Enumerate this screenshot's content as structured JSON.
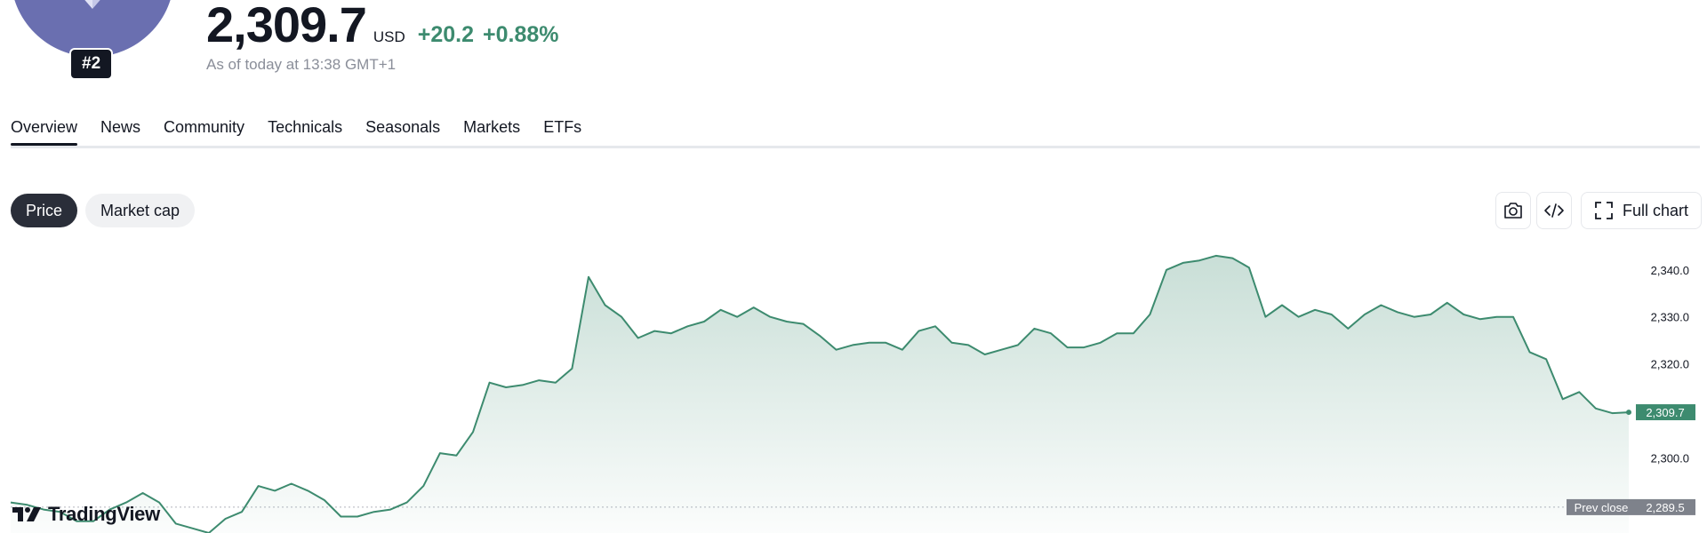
{
  "header": {
    "rank": "#2",
    "price": "2,309.7",
    "currency": "USD",
    "change": "+20.2",
    "change_pct": "+0.88%",
    "as_of": "As of today at 13:38 GMT+1",
    "logo_icon": "ethereum-diamond-icon",
    "logo_color": "#6a6fb0"
  },
  "tabs": [
    {
      "label": "Overview",
      "active": true
    },
    {
      "label": "News"
    },
    {
      "label": "Community"
    },
    {
      "label": "Technicals"
    },
    {
      "label": "Seasonals"
    },
    {
      "label": "Markets"
    },
    {
      "label": "ETFs"
    }
  ],
  "toggle": {
    "price_label": "Price",
    "market_cap_label": "Market cap"
  },
  "toolbar": {
    "full_chart_label": "Full chart",
    "snapshot_icon": "camera-icon",
    "embed_icon": "code-icon",
    "fullscreen_icon": "fullscreen-icon"
  },
  "branding": {
    "label": "TradingView"
  },
  "colors": {
    "line": "#3d8b6f",
    "positive": "#3d8b6f",
    "prev_close_badge": "#7e828b"
  },
  "chart_data": {
    "type": "area",
    "ylim": [
      2284,
      2344.5
    ],
    "y_ticks": [
      "2,340.0",
      "2,330.0",
      "2,320.0",
      "2,300.0"
    ],
    "y_tick_values": [
      2340,
      2330,
      2320,
      2300
    ],
    "last_price_label": "2,309.7",
    "last_price": 2309.7,
    "prev_close_text": "Prev close",
    "prev_close_label": "2,289.5",
    "prev_close": 2289.5,
    "values": [
      2290.5,
      2290,
      2289,
      2288.5,
      2286.5,
      2286.5,
      2289,
      2290.5,
      2292.5,
      2290.5,
      2286,
      2285,
      2284,
      2287,
      2288.5,
      2294,
      2293,
      2294.5,
      2293,
      2291,
      2287.5,
      2287.5,
      2288.5,
      2289,
      2290.5,
      2294,
      2301,
      2300.5,
      2305.5,
      2316,
      2315,
      2315.5,
      2316.5,
      2316,
      2319,
      2338.5,
      2332.5,
      2330,
      2325.5,
      2327,
      2326.5,
      2328,
      2329,
      2331.5,
      2330,
      2332,
      2330,
      2329,
      2328.5,
      2326,
      2323,
      2324,
      2324.5,
      2324.5,
      2323,
      2327,
      2328,
      2324.5,
      2324,
      2322,
      2323,
      2324,
      2327.5,
      2326.5,
      2323.5,
      2323.5,
      2324.5,
      2326.5,
      2326.5,
      2330.5,
      2340,
      2341.5,
      2342,
      2343,
      2342.5,
      2340.5,
      2330,
      2332.5,
      2330,
      2331.5,
      2330.5,
      2327.5,
      2330.5,
      2332.5,
      2331,
      2330,
      2330.5,
      2333,
      2330.5,
      2329.5,
      2330,
      2330,
      2322.5,
      2321,
      2312.5,
      2314,
      2310.5,
      2309.5,
      2309.7
    ]
  }
}
